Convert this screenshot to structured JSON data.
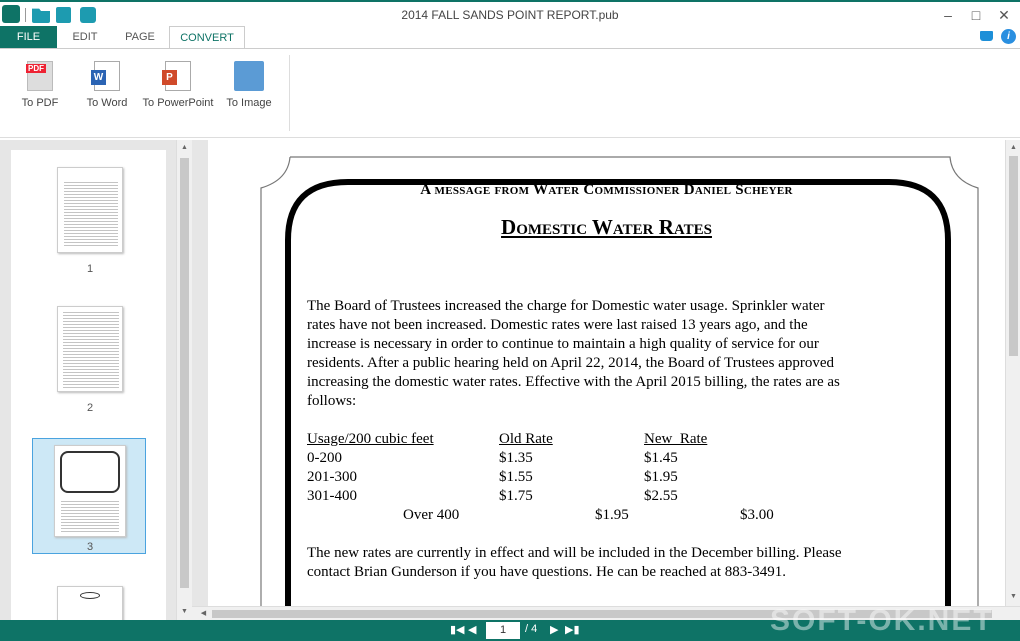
{
  "window": {
    "title": "2014 FALL SANDS POINT REPORT.pub"
  },
  "tabs": [
    {
      "label": "FILE"
    },
    {
      "label": "EDIT"
    },
    {
      "label": "PAGE"
    },
    {
      "label": "CONVERT"
    }
  ],
  "ribbon": {
    "buttons": [
      {
        "label": "To PDF"
      },
      {
        "label": "To Word"
      },
      {
        "label": "To PowerPoint"
      },
      {
        "label": "To Image"
      }
    ],
    "pdf_badge": "PDF",
    "word_letter": "W",
    "ppt_letter": "P"
  },
  "thumbnails": [
    {
      "label": "1"
    },
    {
      "label": "2"
    },
    {
      "label": "3",
      "selected": true
    }
  ],
  "document": {
    "header": "A message from Water Commissioner Daniel Scheyer",
    "title": "Domestic Water Rates",
    "paragraph_lines": [
      "The Board of Trustees increased the charge for Domestic water usage.  Sprinkler water",
      "rates have not been increased.  Domestic rates were last raised 13 years ago, and the",
      "increase is necessary in order to continue to maintain a high quality of service for our",
      "residents.  After a public hearing held on April 22, 2014, the Board of Trustees approved",
      "increasing the domestic water rates.   Effective with the April 2015 billing, the rates are as",
      "follows:"
    ],
    "table": {
      "headers": [
        "Usage/200 cubic feet",
        "Old Rate",
        "New  Rate"
      ],
      "rows": [
        [
          "0-200",
          "$1.35",
          "$1.45"
        ],
        [
          "201-300",
          "$1.55",
          "$1.95"
        ],
        [
          "301-400",
          "$1.75",
          "$2.55"
        ],
        [
          "Over 400",
          "$1.95",
          "$3.00"
        ]
      ]
    },
    "closing_lines": [
      "The new rates are currently in effect and will be included in the December billing.  Please",
      "contact Brian Gunderson if you have questions.  He can be reached at 883-3491."
    ]
  },
  "pager": {
    "current": "1",
    "total": "/ 4"
  },
  "watermark": "SOFT-OK.NET",
  "colors": {
    "accent": "#0e7366",
    "selection": "#cde8f6"
  }
}
